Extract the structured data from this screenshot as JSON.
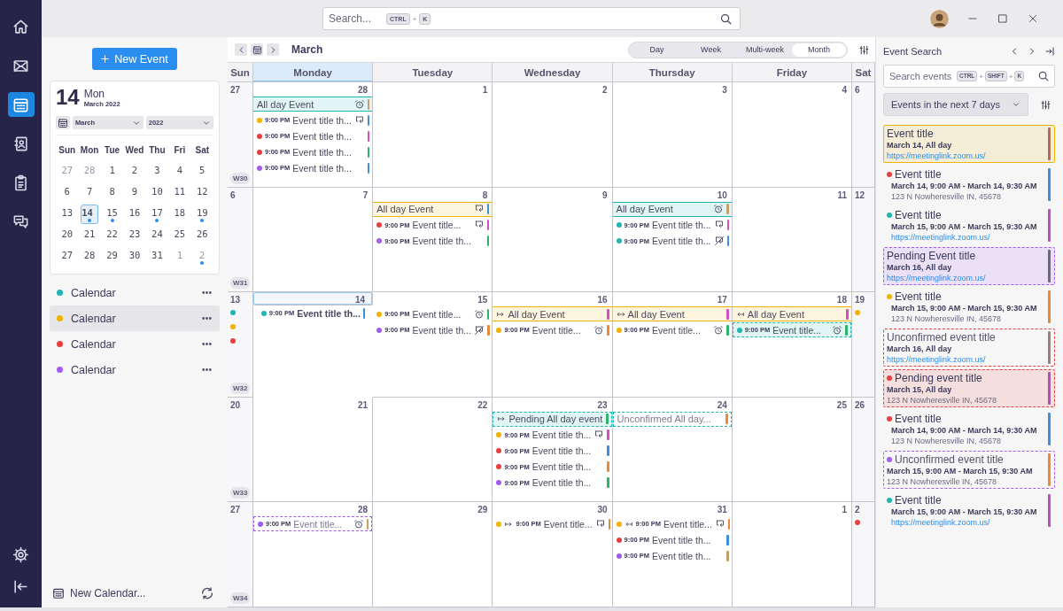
{
  "rail": {
    "top": [
      {
        "kind": "home",
        "selected": false
      },
      {
        "kind": "mail",
        "selected": false
      },
      {
        "kind": "calendar",
        "selected": true
      },
      {
        "kind": "contacts",
        "selected": false
      },
      {
        "kind": "tasks",
        "selected": false
      },
      {
        "kind": "chat",
        "selected": false
      }
    ],
    "bottom": [
      {
        "kind": "settings"
      },
      {
        "kind": "collapse"
      }
    ]
  },
  "topbar": {
    "placeholder": "Search...",
    "shortcut": [
      "CTRL",
      "+",
      "K"
    ]
  },
  "sidebar": {
    "new_event": "New Event",
    "mini_calendar": {
      "day": "14",
      "weekday": "Mon",
      "month_year": "March 2022",
      "month": "March",
      "year": "2022",
      "weekdays": [
        "Sun",
        "Mon",
        "Tue",
        "Wed",
        "Thu",
        "Fri",
        "Sat"
      ],
      "weeks": [
        [
          {
            "label": "27",
            "muted": true,
            "selected": false,
            "marked": false
          },
          {
            "label": "28",
            "muted": true,
            "selected": false,
            "marked": false
          },
          {
            "label": "1",
            "muted": false,
            "selected": false,
            "marked": false
          },
          {
            "label": "2",
            "muted": false,
            "selected": false,
            "marked": false
          },
          {
            "label": "3",
            "muted": false,
            "selected": false,
            "marked": false
          },
          {
            "label": "4",
            "muted": false,
            "selected": false,
            "marked": false
          },
          {
            "label": "5",
            "muted": false,
            "selected": false,
            "marked": false
          }
        ],
        [
          {
            "label": "6",
            "muted": false,
            "selected": false,
            "marked": false
          },
          {
            "label": "7",
            "muted": false,
            "selected": false,
            "marked": false
          },
          {
            "label": "8",
            "muted": false,
            "selected": false,
            "marked": false
          },
          {
            "label": "9",
            "muted": false,
            "selected": false,
            "marked": false
          },
          {
            "label": "10",
            "muted": false,
            "selected": false,
            "marked": false
          },
          {
            "label": "11",
            "muted": false,
            "selected": false,
            "marked": false
          },
          {
            "label": "12",
            "muted": false,
            "selected": false,
            "marked": false
          }
        ],
        [
          {
            "label": "13",
            "muted": false,
            "selected": false,
            "marked": false
          },
          {
            "label": "14",
            "muted": false,
            "selected": true,
            "marked": true
          },
          {
            "label": "15",
            "muted": false,
            "selected": false,
            "marked": true
          },
          {
            "label": "16",
            "muted": false,
            "selected": false,
            "marked": false
          },
          {
            "label": "17",
            "muted": false,
            "selected": false,
            "marked": true
          },
          {
            "label": "18",
            "muted": false,
            "selected": false,
            "marked": false
          },
          {
            "label": "19",
            "muted": false,
            "selected": false,
            "marked": true
          }
        ],
        [
          {
            "label": "20",
            "muted": false,
            "selected": false,
            "marked": false
          },
          {
            "label": "21",
            "muted": false,
            "selected": false,
            "marked": false
          },
          {
            "label": "22",
            "muted": false,
            "selected": false,
            "marked": false
          },
          {
            "label": "23",
            "muted": false,
            "selected": false,
            "marked": false
          },
          {
            "label": "24",
            "muted": false,
            "selected": false,
            "marked": false
          },
          {
            "label": "25",
            "muted": false,
            "selected": false,
            "marked": false
          },
          {
            "label": "26",
            "muted": false,
            "selected": false,
            "marked": false
          }
        ],
        [
          {
            "label": "27",
            "muted": false,
            "selected": false,
            "marked": false
          },
          {
            "label": "28",
            "muted": false,
            "selected": false,
            "marked": false
          },
          {
            "label": "29",
            "muted": false,
            "selected": false,
            "marked": false
          },
          {
            "label": "30",
            "muted": false,
            "selected": false,
            "marked": false
          },
          {
            "label": "31",
            "muted": false,
            "selected": false,
            "marked": false
          },
          {
            "label": "1",
            "muted": true,
            "selected": false,
            "marked": false
          },
          {
            "label": "2",
            "muted": true,
            "selected": false,
            "marked": true
          }
        ]
      ]
    },
    "calendars": [
      {
        "label": "Calendar",
        "color": "#1fb5b5",
        "selected": false
      },
      {
        "label": "Calendar",
        "color": "#f0b400",
        "selected": true
      },
      {
        "label": "Calendar",
        "color": "#e8403f",
        "selected": false
      },
      {
        "label": "Calendar",
        "color": "#a25cf0",
        "selected": false
      }
    ],
    "new_calendar": "New Calendar..."
  },
  "toolbar": {
    "title": "March",
    "views": [
      {
        "label": "Day",
        "selected": false
      },
      {
        "label": "Week",
        "selected": false
      },
      {
        "label": "Multi-week",
        "selected": false
      },
      {
        "label": "Month",
        "selected": true
      }
    ]
  },
  "calendar": {
    "weekdays": [
      {
        "label": "Sun",
        "selected": false
      },
      {
        "label": "Monday",
        "selected": true
      },
      {
        "label": "Tuesday",
        "selected": false
      },
      {
        "label": "Wednesday",
        "selected": false
      },
      {
        "label": "Thursday",
        "selected": false
      },
      {
        "label": "Friday",
        "selected": false
      },
      {
        "label": "Sat",
        "selected": false
      }
    ],
    "weeks": [
      {
        "week": "W30",
        "days": [
          {
            "date": "27",
            "selected": false
          },
          {
            "date": "28",
            "selected": false,
            "events": [
              {
                "kind": "allday",
                "color": "#1fb5b5",
                "title": "All day Event",
                "pending": false,
                "unconfirmed": false,
                "icons": [
                  {
                    "kind": "alarm"
                  }
                ],
                "bar": {
                  "color": "#c4a06a"
                }
              },
              {
                "kind": "timed",
                "color": "#f0b400",
                "time": "9:00 PM",
                "title": "Event title th...",
                "pending": false,
                "unconfirmed": false,
                "icons": [
                  {
                    "kind": "repeat"
                  }
                ],
                "bar": {
                  "color": "#3d8fdc"
                }
              },
              {
                "kind": "timed",
                "color": "#e8403f",
                "time": "9:00 PM",
                "title": "Event title th...",
                "pending": false,
                "unconfirmed": false,
                "bar": {
                  "color": "#d24fc4"
                }
              },
              {
                "kind": "timed",
                "color": "#e8403f",
                "time": "9:00 PM",
                "title": "Event title th...",
                "pending": false,
                "unconfirmed": false,
                "bar": {
                  "color": "#2eb36b"
                }
              },
              {
                "kind": "timed",
                "color": "#a25cf0",
                "time": "9:00 PM",
                "title": "Event title th...",
                "pending": false,
                "unconfirmed": false,
                "bar": {
                  "color": "#3d8fdc"
                }
              }
            ]
          },
          {
            "date": "1",
            "selected": false
          },
          {
            "date": "2",
            "selected": false
          },
          {
            "date": "3",
            "selected": false
          },
          {
            "date": "4",
            "selected": false
          },
          {
            "date": "6",
            "selected": false
          }
        ]
      },
      {
        "week": "W31",
        "days": [
          {
            "date": "6",
            "selected": false
          },
          {
            "date": "7",
            "selected": false
          },
          {
            "date": "8",
            "selected": false,
            "events": [
              {
                "kind": "allday",
                "color": "#f0b400",
                "title": "All day Event",
                "pending": false,
                "unconfirmed": false,
                "icons": [
                  {
                    "kind": "repeat"
                  }
                ],
                "bar": {
                  "color": "#3d8fdc"
                }
              },
              {
                "kind": "timed",
                "color": "#e8403f",
                "time": "9:00 PM",
                "title": "Event title...",
                "pending": false,
                "unconfirmed": false,
                "icons": [
                  {
                    "kind": "repeat"
                  }
                ],
                "bar": {
                  "color": "#d24fc4"
                }
              },
              {
                "kind": "timed",
                "color": "#a25cf0",
                "time": "9:00 PM",
                "title": "Event title th...",
                "pending": false,
                "unconfirmed": false,
                "bar": {
                  "color": "#2eb36b"
                }
              }
            ]
          },
          {
            "date": "9",
            "selected": false
          },
          {
            "date": "10",
            "selected": false,
            "events": [
              {
                "kind": "allday",
                "color": "#1fb5b5",
                "title": "All day Event",
                "pending": false,
                "unconfirmed": false,
                "icons": [
                  {
                    "kind": "alarm"
                  }
                ],
                "bar": {
                  "color": "#c4a06a"
                }
              },
              {
                "kind": "timed",
                "color": "#1fb5b5",
                "time": "9:00 PM",
                "title": "Event title th...",
                "pending": false,
                "unconfirmed": false,
                "icons": [
                  {
                    "kind": "repeat"
                  }
                ],
                "bar": {
                  "color": "#d24fc4"
                }
              },
              {
                "kind": "timed",
                "color": "#1fb5b5",
                "time": "9:00 PM",
                "title": "Event title th...",
                "pending": false,
                "unconfirmed": false,
                "icons": [
                  {
                    "kind": "repeat-off"
                  }
                ],
                "bar": {
                  "color": "#3d8fdc"
                }
              }
            ]
          },
          {
            "date": "11",
            "selected": false
          },
          {
            "date": "12",
            "selected": false
          }
        ]
      },
      {
        "week": "W32",
        "days": [
          {
            "date": "13",
            "selected": false,
            "dots": [
              {
                "color": "#1fb5b5"
              },
              {
                "color": "#f0b400"
              },
              {
                "color": "#e8403f"
              }
            ]
          },
          {
            "date": "14",
            "selected": true,
            "events": [
              {
                "kind": "timed",
                "color": "#1fb5b5",
                "time": "9:00 PM",
                "title": "Event title th...",
                "pending": false,
                "unconfirmed": false,
                "bar": {
                  "color": "#3d8fdc"
                }
              }
            ]
          },
          {
            "date": "15",
            "selected": false,
            "events": [
              {
                "kind": "timed",
                "color": "#f0b400",
                "time": "9:00 PM",
                "title": "Event title...",
                "pending": false,
                "unconfirmed": false,
                "icons": [
                  {
                    "kind": "alarm"
                  }
                ],
                "bar": {
                  "color": "#2eb36b"
                }
              },
              {
                "kind": "timed",
                "color": "#a25cf0",
                "time": "9:00 PM",
                "title": "Event title th...",
                "pending": false,
                "unconfirmed": false,
                "icons": [
                  {
                    "kind": "repeat-off"
                  }
                ],
                "bar": {
                  "color": "#e98a3a"
                }
              }
            ]
          },
          {
            "date": "16",
            "selected": false,
            "events": [
              {
                "kind": "allday",
                "color": "#f0b400",
                "title": "All day Event",
                "pending": false,
                "unconfirmed": false,
                "arrows": [
                  {
                    "kind": "right"
                  }
                ],
                "bar": {
                  "color": "#d24fc4"
                }
              },
              {
                "kind": "timed",
                "color": "#f0b400",
                "time": "9:00 PM",
                "title": "Event title...",
                "pending": false,
                "unconfirmed": false,
                "icons": [
                  {
                    "kind": "alarm"
                  }
                ],
                "bar": {
                  "color": "#e98a3a"
                }
              }
            ]
          },
          {
            "date": "17",
            "selected": false,
            "events": [
              {
                "kind": "allday",
                "color": "#f0b400",
                "title": "All day Event",
                "pending": false,
                "unconfirmed": false,
                "arrows": [
                  {
                    "kind": "both"
                  }
                ],
                "bar": {
                  "color": "#d24fc4"
                }
              },
              {
                "kind": "timed",
                "color": "#f0b400",
                "time": "9:00 PM",
                "title": "Event title...",
                "pending": false,
                "unconfirmed": false,
                "icons": [
                  {
                    "kind": "alarm"
                  }
                ],
                "bar": {
                  "color": "#2eb36b"
                }
              }
            ]
          },
          {
            "date": "18",
            "selected": false,
            "events": [
              {
                "kind": "allday",
                "color": "#f0b400",
                "title": "All day Event",
                "pending": false,
                "unconfirmed": false,
                "arrows": [
                  {
                    "kind": "left"
                  }
                ],
                "bar": {
                  "color": "#d24fc4"
                }
              },
              {
                "kind": "timed",
                "color": "#1fb5b5",
                "time": "9:00 PM",
                "title": "Event title...",
                "pending": true,
                "unconfirmed": false,
                "icons": [
                  {
                    "kind": "alarm"
                  }
                ],
                "bar": {
                  "color": "#2eb36b"
                }
              }
            ]
          },
          {
            "date": "19",
            "selected": false,
            "dots": [
              {
                "color": "#f0b400"
              }
            ]
          }
        ]
      },
      {
        "week": "W33",
        "days": [
          {
            "date": "20",
            "selected": false
          },
          {
            "date": "21",
            "selected": false
          },
          {
            "date": "22",
            "selected": false
          },
          {
            "date": "23",
            "selected": false,
            "events": [
              {
                "kind": "allday",
                "color": "#1fb5b5",
                "title": "Pending All day event",
                "pending": true,
                "unconfirmed": false,
                "arrows": [
                  {
                    "kind": "right"
                  }
                ],
                "bar": {
                  "color": "#2eb36b"
                }
              },
              {
                "kind": "timed",
                "color": "#f0b400",
                "time": "9:00 PM",
                "title": "Event title th...",
                "pending": false,
                "unconfirmed": false,
                "icons": [
                  {
                    "kind": "repeat"
                  }
                ],
                "bar": {
                  "color": "#d24fc4"
                }
              },
              {
                "kind": "timed",
                "color": "#e8403f",
                "time": "9:00 PM",
                "title": "Event title th...",
                "pending": false,
                "unconfirmed": false,
                "bar": {
                  "color": "#3d8fdc"
                }
              },
              {
                "kind": "timed",
                "color": "#e8403f",
                "time": "9:00 PM",
                "title": "Event title th...",
                "pending": false,
                "unconfirmed": false,
                "bar": {
                  "color": "#e98a3a"
                }
              },
              {
                "kind": "timed",
                "color": "#a25cf0",
                "time": "9:00 PM",
                "title": "Event title th...",
                "pending": false,
                "unconfirmed": false,
                "bar": {
                  "color": "#2eb36b"
                }
              }
            ]
          },
          {
            "date": "24",
            "selected": false,
            "events": [
              {
                "kind": "allday",
                "color": "#1fb5b5",
                "title": "Unconfirmed All day...",
                "pending": false,
                "unconfirmed": true,
                "bar": {
                  "color": "#e98a3a"
                }
              }
            ]
          },
          {
            "date": "25",
            "selected": false
          },
          {
            "date": "26",
            "selected": false
          }
        ]
      },
      {
        "week": "W34",
        "days": [
          {
            "date": "27",
            "selected": false
          },
          {
            "date": "28",
            "selected": false,
            "events": [
              {
                "kind": "timed",
                "color": "#a25cf0",
                "time": "9:00 PM",
                "title": "Event title...",
                "pending": false,
                "unconfirmed": true,
                "icons": [
                  {
                    "kind": "alarm"
                  }
                ],
                "bar": {
                  "color": "#c4a06a"
                }
              }
            ]
          },
          {
            "date": "29",
            "selected": false
          },
          {
            "date": "30",
            "selected": false,
            "events": [
              {
                "kind": "timed",
                "color": "#f0b400",
                "time": "9:00 PM",
                "title": "Event title...",
                "pending": false,
                "unconfirmed": false,
                "arrows": [
                  {
                    "kind": "right"
                  }
                ],
                "icons": [
                  {
                    "kind": "repeat"
                  }
                ],
                "bar": {
                  "color": "#e98a3a"
                }
              }
            ]
          },
          {
            "date": "31",
            "selected": false,
            "events": [
              {
                "kind": "timed",
                "color": "#f0b400",
                "time": "9:00 PM",
                "title": "Event title...",
                "pending": false,
                "unconfirmed": false,
                "arrows": [
                  {
                    "kind": "left"
                  }
                ],
                "icons": [
                  {
                    "kind": "repeat"
                  }
                ],
                "bar": {
                  "color": "#e98a3a"
                }
              },
              {
                "kind": "timed",
                "color": "#e8403f",
                "time": "9:00 PM",
                "title": "Event title th...",
                "pending": false,
                "unconfirmed": false,
                "bar": {
                  "color": "#3d8fdc"
                }
              },
              {
                "kind": "timed",
                "color": "#a25cf0",
                "time": "9:00 PM",
                "title": "Event title th...",
                "pending": false,
                "unconfirmed": false,
                "bar": {
                  "color": "#c4a06a"
                }
              }
            ]
          },
          {
            "date": "1",
            "selected": false
          },
          {
            "date": "2",
            "selected": false,
            "dots": [
              {
                "color": "#e8403f"
              }
            ]
          }
        ]
      }
    ]
  },
  "search_panel": {
    "title": "Event Search",
    "placeholder": "Search events",
    "shortcut": [
      "CTRL",
      "+",
      "SHIFT",
      "+",
      "K"
    ],
    "range": "Events in the next 7 days",
    "results": [
      {
        "title": "Event title",
        "when": "March 14, All day",
        "detail": "https://meetinglink.zoom.us/",
        "link": true,
        "pending": false,
        "unconfirmed": false,
        "dot": false,
        "color": "#f0b400",
        "bar": {
          "color": "#b86a5a"
        }
      },
      {
        "title": "Event title",
        "when": "March 14, 9:00 AM - March 14, 9:30 AM",
        "detail": "123 N Nowheresville IN, 45678",
        "link": false,
        "pending": false,
        "unconfirmed": false,
        "dot": true,
        "color": "#e8403f",
        "bar": {
          "color": "#3d8fdc"
        }
      },
      {
        "title": "Event title",
        "when": "March 15, 9:00 AM - March 15, 9:30 AM",
        "detail": "https://meetinglink.zoom.us/",
        "link": true,
        "pending": false,
        "unconfirmed": false,
        "dot": true,
        "color": "#1fb5b5",
        "bar": {
          "color": "#c04fc4"
        }
      },
      {
        "title": "Pending Event title",
        "when": "March 16, All day",
        "detail": "https://meetinglink.zoom.us/",
        "link": true,
        "pending": true,
        "unconfirmed": false,
        "dot": false,
        "color": "#a25cf0",
        "bar": {
          "color": "#6a6880"
        }
      },
      {
        "title": "Event title",
        "when": "March 15, 9:00 AM - March 15, 9:30 AM",
        "detail": "123 N Nowheresville IN, 45678",
        "link": false,
        "pending": false,
        "unconfirmed": false,
        "dot": true,
        "color": "#f0b400",
        "bar": {
          "color": "#e98a3a"
        }
      },
      {
        "title": "Unconfirmed event title",
        "when": "March 16, All day",
        "detail": "https://meetinglink.zoom.us/",
        "link": true,
        "pending": false,
        "unconfirmed": true,
        "dot": false,
        "color": "#e8403f",
        "bar": {
          "color": "#9a8080"
        }
      },
      {
        "title": "Pending event title",
        "when": "March 15, All day",
        "detail": "123 N Nowheresville IN, 45678",
        "link": false,
        "pending": true,
        "unconfirmed": false,
        "dot": true,
        "color": "#e8403f",
        "bar": {
          "color": "#b04fc0"
        }
      },
      {
        "title": "Event title",
        "when": "March 14, 9:00 AM - March 14, 9:30 AM",
        "detail": "123 N Nowheresville IN, 45678",
        "link": false,
        "pending": false,
        "unconfirmed": false,
        "dot": true,
        "color": "#e8403f",
        "bar": {
          "color": "#3d8fdc"
        }
      },
      {
        "title": "Unconfirmed event title",
        "when": "March 15, 9:00 AM - March 15, 9:30 AM",
        "detail": "123 N Nowheresville IN, 45678",
        "link": false,
        "pending": false,
        "unconfirmed": true,
        "dot": true,
        "color": "#a25cf0",
        "bar": {
          "color": "#e98a3a"
        }
      },
      {
        "title": "Event title",
        "when": "March 15, 9:00 AM - March 15, 9:30 AM",
        "detail": "https://meetinglink.zoom.us/",
        "link": true,
        "pending": false,
        "unconfirmed": false,
        "dot": true,
        "color": "#1fb5b5",
        "bar": {
          "color": "#c04fc4"
        }
      }
    ]
  }
}
